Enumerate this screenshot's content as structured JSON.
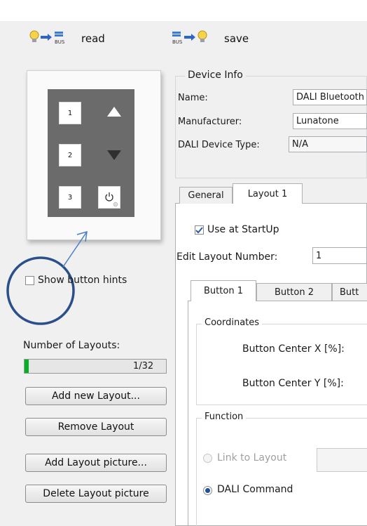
{
  "toolbar": {
    "read_label": "read",
    "save_label": "save"
  },
  "preview": {
    "buttons": [
      "1",
      "2",
      "3"
    ]
  },
  "show_hints": {
    "label": "Show button hints",
    "checked": false
  },
  "layouts": {
    "label": "Number of Layouts:",
    "progress_text": "1/32",
    "progress_fraction": 0.03125,
    "add_button": "Add new Layout...",
    "remove_button": "Remove  Layout",
    "add_picture_button": "Add Layout picture...",
    "delete_picture_button": "Delete Layout picture"
  },
  "device_info": {
    "legend": "Device Info",
    "name_label": "Name:",
    "name_value": "DALI Bluetooth",
    "manufacturer_label": "Manufacturer:",
    "manufacturer_value": "Lunatone",
    "type_label": "DALI Device Type:",
    "type_value": "N/A"
  },
  "tabs": {
    "general": "General",
    "layout1": "Layout 1"
  },
  "layout": {
    "use_startup_label": "Use at StartUp",
    "use_startup_checked": true,
    "edit_layout_label": "Edit Layout Number:",
    "edit_layout_value": "1"
  },
  "button_tabs": [
    "Button 1",
    "Button 2",
    "Butt"
  ],
  "coordinates": {
    "legend": "Coordinates",
    "center_x_label": "Button Center X [%]:",
    "center_y_label": "Button Center Y [%]:"
  },
  "function": {
    "legend": "Function",
    "link_label": "Link to Layout",
    "dali_label": "DALI Command",
    "selected": "dali"
  },
  "colors": {
    "annotation_blue": "#2b4f8a",
    "arrow_blue": "#4a7ec4",
    "device_gray": "#6b6b6b"
  }
}
